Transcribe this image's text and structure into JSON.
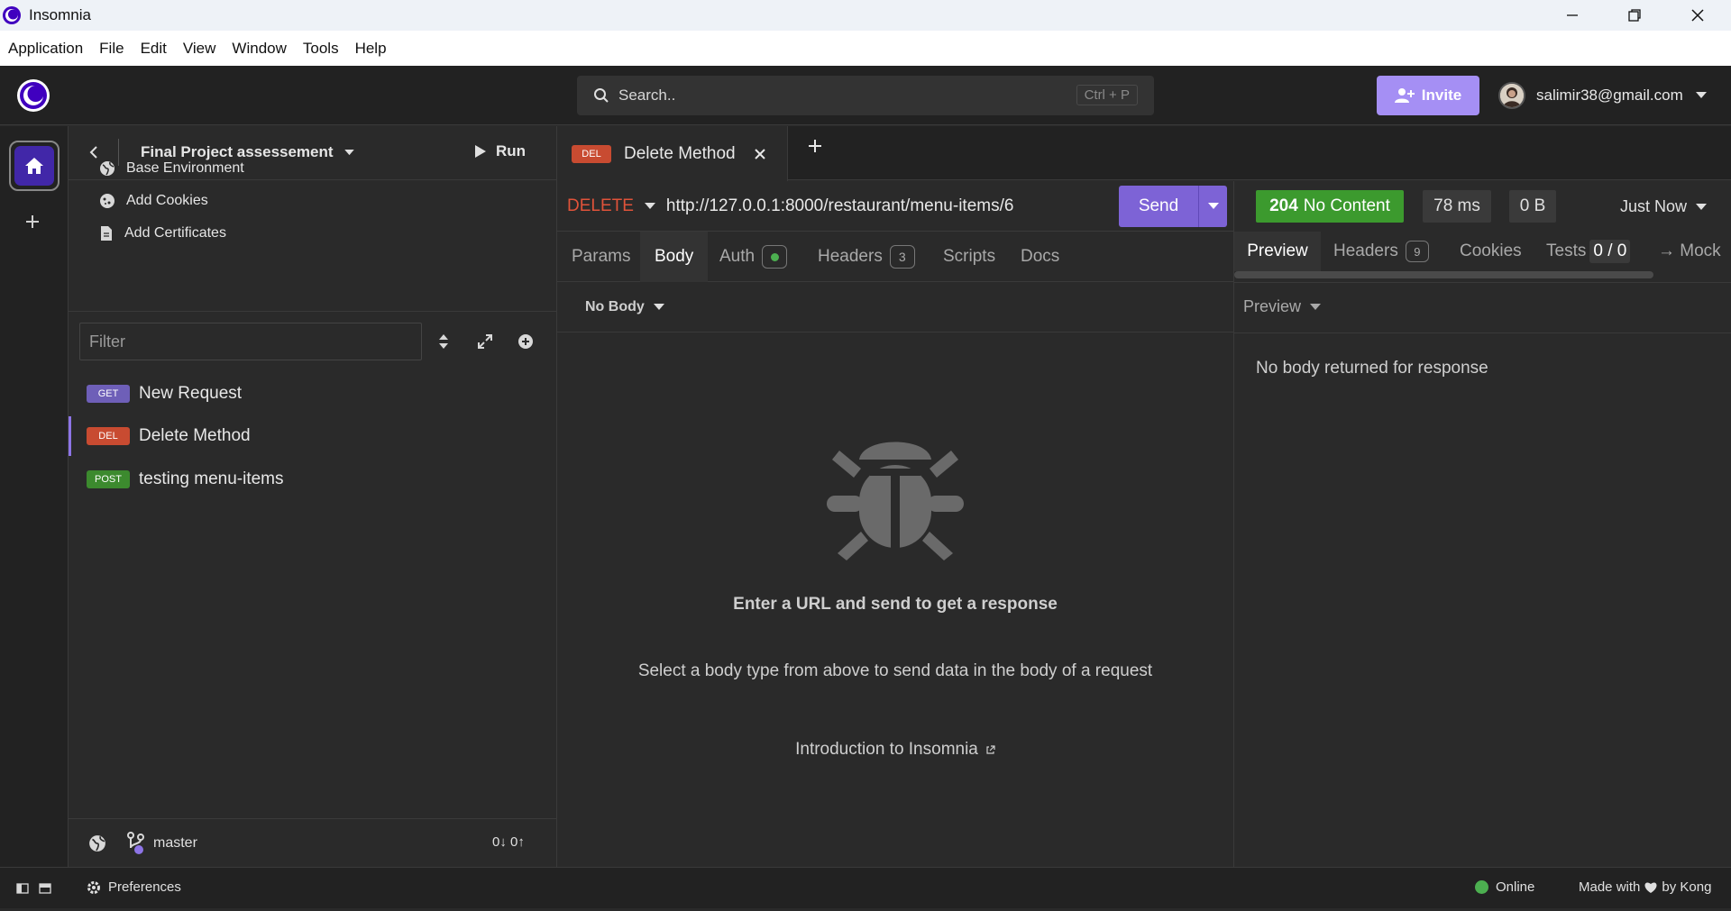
{
  "window": {
    "title": "Insomnia"
  },
  "menu": [
    "Application",
    "File",
    "Edit",
    "View",
    "Window",
    "Tools",
    "Help"
  ],
  "header": {
    "search_placeholder": "Search..",
    "search_shortcut": "Ctrl + P",
    "invite_label": "Invite",
    "account_email": "salimir38@gmail.com"
  },
  "sidebar": {
    "workspace_name": "Final Project assessement",
    "run_label": "Run",
    "env_items": [
      {
        "label": "Base Environment",
        "icon": "globe-icon"
      },
      {
        "label": "Add Cookies",
        "icon": "cookie-icon"
      },
      {
        "label": "Add Certificates",
        "icon": "certificate-icon"
      }
    ],
    "filter_placeholder": "Filter",
    "requests": [
      {
        "method": "GET",
        "name": "New Request",
        "color": "#6e5fb8"
      },
      {
        "method": "DEL",
        "name": "Delete Method",
        "color": "#c84b31"
      },
      {
        "method": "POST",
        "name": "testing menu-items",
        "color": "#3c8a2e"
      }
    ],
    "branch": "master",
    "sync_counts": "0↓ 0↑"
  },
  "tab": {
    "method": "DEL",
    "name": "Delete Method"
  },
  "request": {
    "method": "DELETE",
    "url": "http://127.0.0.1:8000/restaurant/menu-items/6",
    "send_label": "Send",
    "tabs": {
      "params": "Params",
      "body": "Body",
      "auth": "Auth",
      "headers": "Headers",
      "headers_count": "3",
      "scripts": "Scripts",
      "docs": "Docs"
    },
    "body_type": "No Body",
    "empty_title": "Enter a URL and send to get a response",
    "empty_subtitle": "Select a body type from above to send data in the body of a request",
    "intro_link": "Introduction to Insomnia"
  },
  "response": {
    "status_code": "204",
    "status_text": "No Content",
    "time": "78 ms",
    "size": "0 B",
    "timestamp": "Just Now",
    "tabs": {
      "preview": "Preview",
      "headers": "Headers",
      "headers_count": "9",
      "cookies": "Cookies",
      "tests": "Tests",
      "tests_count": "0 / 0",
      "mock": "→ Mock"
    },
    "preview_mode": "Preview",
    "body_message": "No body returned for response"
  },
  "footer": {
    "preferences": "Preferences",
    "status": "Online",
    "made_with_prefix": "Made with",
    "made_with_suffix": "by Kong"
  },
  "colors": {
    "accent": "#7d63d6",
    "delete": "#c84b31",
    "success": "#3c9a2e",
    "online": "#4caf50"
  }
}
